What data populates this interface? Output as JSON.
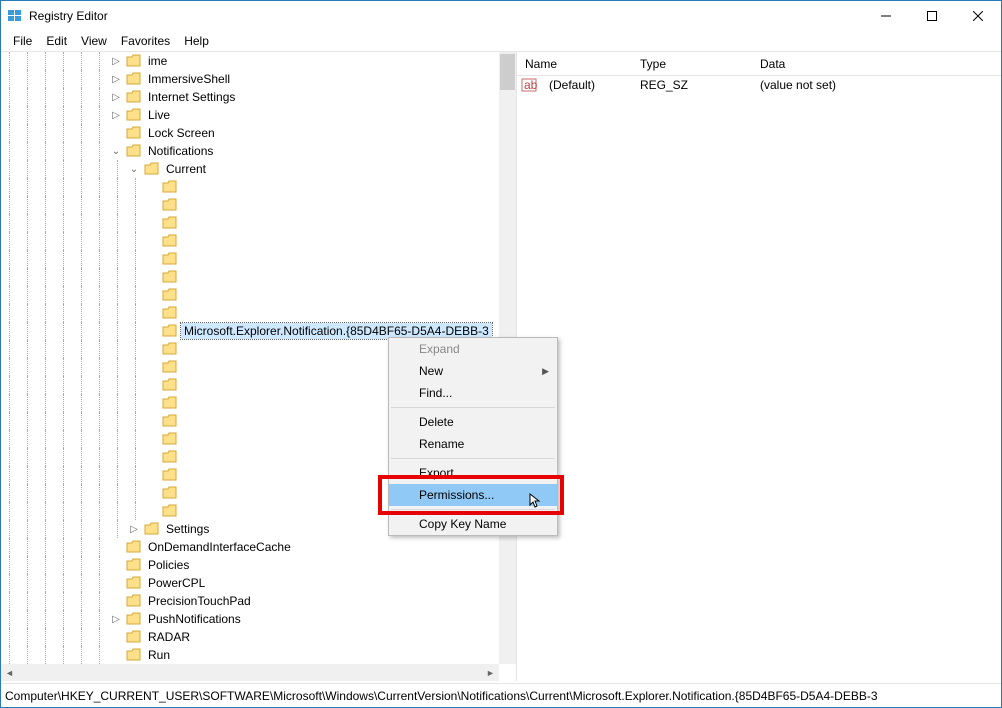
{
  "window": {
    "title": "Registry Editor"
  },
  "menu": {
    "file": "File",
    "edit": "Edit",
    "view": "View",
    "favorites": "Favorites",
    "help": "Help"
  },
  "tree": {
    "items": [
      {
        "depth": 6,
        "exp": ">",
        "label": "ime"
      },
      {
        "depth": 6,
        "exp": ">",
        "label": "ImmersiveShell"
      },
      {
        "depth": 6,
        "exp": ">",
        "label": "Internet Settings"
      },
      {
        "depth": 6,
        "exp": ">",
        "label": "Live"
      },
      {
        "depth": 6,
        "exp": "",
        "label": "Lock Screen"
      },
      {
        "depth": 6,
        "exp": "v",
        "label": "Notifications"
      },
      {
        "depth": 7,
        "exp": "v",
        "label": "Current"
      },
      {
        "depth": 8,
        "exp": "",
        "label": ""
      },
      {
        "depth": 8,
        "exp": "",
        "label": ""
      },
      {
        "depth": 8,
        "exp": "",
        "label": ""
      },
      {
        "depth": 8,
        "exp": "",
        "label": ""
      },
      {
        "depth": 8,
        "exp": "",
        "label": ""
      },
      {
        "depth": 8,
        "exp": "",
        "label": ""
      },
      {
        "depth": 8,
        "exp": "",
        "label": ""
      },
      {
        "depth": 8,
        "exp": "",
        "label": ""
      },
      {
        "depth": 8,
        "exp": "",
        "label": "Microsoft.Explorer.Notification.{85D4BF65-D5A4-DEBB-3",
        "selected": true
      },
      {
        "depth": 8,
        "exp": "",
        "label": ""
      },
      {
        "depth": 8,
        "exp": "",
        "label": ""
      },
      {
        "depth": 8,
        "exp": "",
        "label": ""
      },
      {
        "depth": 8,
        "exp": "",
        "label": ""
      },
      {
        "depth": 8,
        "exp": "",
        "label": ""
      },
      {
        "depth": 8,
        "exp": "",
        "label": ""
      },
      {
        "depth": 8,
        "exp": "",
        "label": ""
      },
      {
        "depth": 8,
        "exp": "",
        "label": ""
      },
      {
        "depth": 8,
        "exp": "",
        "label": ""
      },
      {
        "depth": 8,
        "exp": "",
        "label": ""
      },
      {
        "depth": 7,
        "exp": ">",
        "label": "Settings"
      },
      {
        "depth": 6,
        "exp": "",
        "label": "OnDemandInterfaceCache"
      },
      {
        "depth": 6,
        "exp": "",
        "label": "Policies"
      },
      {
        "depth": 6,
        "exp": "",
        "label": "PowerCPL"
      },
      {
        "depth": 6,
        "exp": "",
        "label": "PrecisionTouchPad"
      },
      {
        "depth": 6,
        "exp": ">",
        "label": "PushNotifications"
      },
      {
        "depth": 6,
        "exp": "",
        "label": "RADAR"
      },
      {
        "depth": 6,
        "exp": "",
        "label": "Run"
      }
    ]
  },
  "list": {
    "headers": {
      "name": "Name",
      "type": "Type",
      "data": "Data"
    },
    "rows": [
      {
        "name": "(Default)",
        "type": "REG_SZ",
        "data": "(value not set)"
      }
    ]
  },
  "context": {
    "expand": "Expand",
    "new": "New",
    "find": "Find...",
    "delete": "Delete",
    "rename": "Rename",
    "export": "Export",
    "permissions": "Permissions...",
    "copykey": "Copy Key Name"
  },
  "status": {
    "path": "Computer\\HKEY_CURRENT_USER\\SOFTWARE\\Microsoft\\Windows\\CurrentVersion\\Notifications\\Current\\Microsoft.Explorer.Notification.{85D4BF65-D5A4-DEBB-3"
  }
}
